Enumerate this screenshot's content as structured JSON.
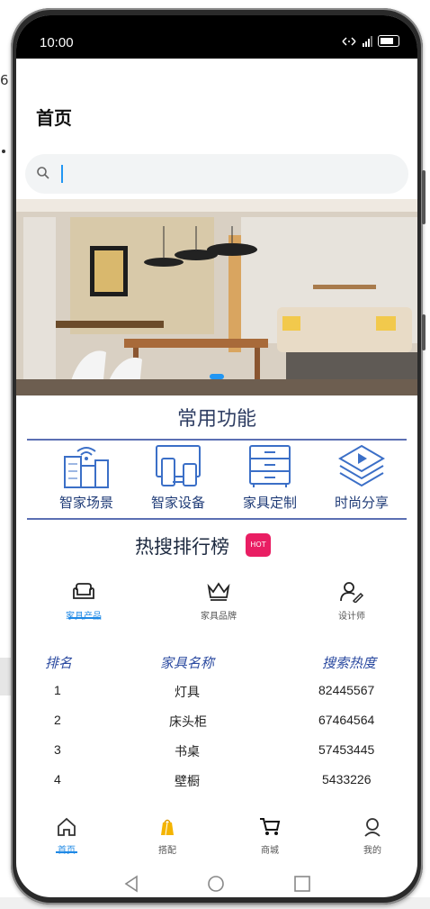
{
  "status_bar": {
    "time": "10:00"
  },
  "header": {
    "title": "首页"
  },
  "search": {
    "placeholder": ""
  },
  "common_functions": {
    "title": "常用功能",
    "items": [
      {
        "label": "智家场景",
        "icon": "smart-home-scene-icon"
      },
      {
        "label": "智家设备",
        "icon": "smart-device-icon"
      },
      {
        "label": "家具定制",
        "icon": "furniture-custom-icon"
      },
      {
        "label": "时尚分享",
        "icon": "fashion-share-icon"
      }
    ]
  },
  "hot_search": {
    "title": "热搜排行榜",
    "badge": "HOT",
    "tabs": [
      {
        "label": "家具产品",
        "icon": "sofa-icon",
        "active": true
      },
      {
        "label": "家具品牌",
        "icon": "crown-icon",
        "active": false
      },
      {
        "label": "设计师",
        "icon": "designer-icon",
        "active": false
      }
    ],
    "columns": [
      "排名",
      "家具名称",
      "搜索热度"
    ],
    "rows": [
      {
        "rank": "1",
        "name": "灯具",
        "heat": "82445567"
      },
      {
        "rank": "2",
        "name": "床头柜",
        "heat": "67464564"
      },
      {
        "rank": "3",
        "name": "书桌",
        "heat": "57453445"
      },
      {
        "rank": "4",
        "name": "壁橱",
        "heat": "5433226"
      }
    ]
  },
  "bottom_nav": [
    {
      "label": "首页",
      "icon": "home-icon",
      "active": true
    },
    {
      "label": "搭配",
      "icon": "outfit-bag-icon",
      "active": false
    },
    {
      "label": "商城",
      "icon": "cart-icon",
      "active": false
    },
    {
      "label": "我的",
      "icon": "profile-icon",
      "active": false
    }
  ],
  "colors": {
    "accent": "#1e88e5",
    "section_title": "#2f3e63",
    "table_header": "#2b4aa0",
    "hot_badge": "#e91e63"
  }
}
